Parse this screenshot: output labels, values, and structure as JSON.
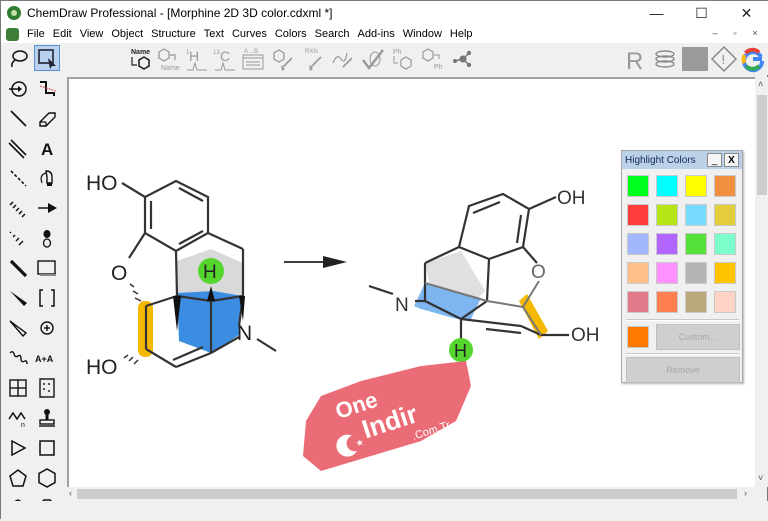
{
  "window": {
    "title": "ChemDraw Professional - [Morphine 2D 3D color.cdxml *]",
    "controls": {
      "minimize": "—",
      "maximize": "☐",
      "close": "✕"
    },
    "mdi_controls": {
      "minimize": "–",
      "restore": "▫",
      "close": "×"
    }
  },
  "menu": {
    "items": [
      "File",
      "Edit",
      "View",
      "Object",
      "Structure",
      "Text",
      "Curves",
      "Colors",
      "Search",
      "Add-ins",
      "Window",
      "Help"
    ]
  },
  "toolbar": {
    "items": [
      {
        "icon": "name-to-structure-icon",
        "label": "Name"
      },
      {
        "icon": "structure-to-name-icon",
        "label": "Name"
      },
      {
        "icon": "h1-nmr-icon",
        "label": "1H"
      },
      {
        "icon": "c13-nmr-icon",
        "label": "13C"
      },
      {
        "icon": "reaction-table-icon",
        "label": "A→B"
      },
      {
        "icon": "clean-structure-icon",
        "label": ""
      },
      {
        "icon": "clean-reaction-icon",
        "label": "RXN"
      },
      {
        "icon": "clean-biopolymer-icon",
        "label": ""
      },
      {
        "icon": "check-structure-icon",
        "label": ""
      },
      {
        "icon": "expand-label-icon",
        "label": "Ph"
      },
      {
        "icon": "contract-label-icon",
        "label": "Ph"
      },
      {
        "icon": "molecule-3d-icon",
        "label": ""
      }
    ],
    "right_items": [
      {
        "icon": "r-group-icon",
        "label": "R"
      },
      {
        "icon": "stack-icon",
        "label": ""
      },
      {
        "icon": "gray-panel-icon",
        "label": ""
      },
      {
        "icon": "warning-icon",
        "label": "!"
      },
      {
        "icon": "google-search-icon",
        "label": "G"
      }
    ]
  },
  "palette": {
    "tools": [
      "lasso-icon",
      "marquee-select-icon",
      "rotate-icon",
      "chain-icon",
      "solid-bond-icon",
      "eraser-icon",
      "multiple-bond-icon",
      "text-icon",
      "dashed-bond-icon",
      "pen-icon",
      "hashed-bond-icon",
      "arrow-icon",
      "hashed-wedge-icon",
      "orbital-icon",
      "bold-bond-icon",
      "drawing-element-icon",
      "wedge-bond-icon",
      "bracket-icon",
      "hollow-wedge-icon",
      "charge-icon",
      "wavy-bond-icon",
      "query-icon",
      "table-icon",
      "tlc-plate-icon",
      "polymer-icon",
      "template-stamp-icon",
      "cyclopropane-icon",
      "cyclobutane-icon",
      "cyclopentane-icon",
      "cyclohexane-icon",
      "cycloheptane-icon",
      "cyclooctane-icon"
    ],
    "labels": {
      "text": "A",
      "query": "A+A",
      "brackets": "[ ]"
    }
  },
  "canvas": {
    "left_molecule": {
      "labels": {
        "ho_top": "HO",
        "o_ring": "O",
        "ho_bottom": "HO",
        "n": "N",
        "h": "H"
      }
    },
    "reaction_arrow": "→",
    "right_molecule": {
      "labels": {
        "oh_top": "OH",
        "o_ring": "O",
        "oh_right": "OH",
        "n": "N",
        "h": "H"
      }
    },
    "watermark": {
      "line1": "One",
      "line2": "Indir",
      "line3": ".Com.Tr"
    },
    "highlight_colors": {
      "gray_ring": "#d9d9d9",
      "blue_ring": "#3a8de0",
      "yellow_bond": "#f5b800",
      "h_circle": "#55d62f"
    }
  },
  "highlight_panel": {
    "title": "Highlight Colors",
    "minimize": "_",
    "close": "X",
    "swatches": [
      "#00ff1f",
      "#00ffff",
      "#ffff00",
      "#ef8f3f",
      "#ff3c3c",
      "#b5e516",
      "#77dcff",
      "#e3cd3c",
      "#a3b7ff",
      "#b365ff",
      "#55e03a",
      "#7dffcb",
      "#ffc08a",
      "#ff90ff",
      "#b4b4b4",
      "#ffc300",
      "#e07a8a",
      "#ff7f50",
      "#bba97e",
      "#ffd4c7"
    ],
    "current_color": "#ff7a00",
    "custom_label": "Custom...",
    "remove_label": "Remove"
  }
}
